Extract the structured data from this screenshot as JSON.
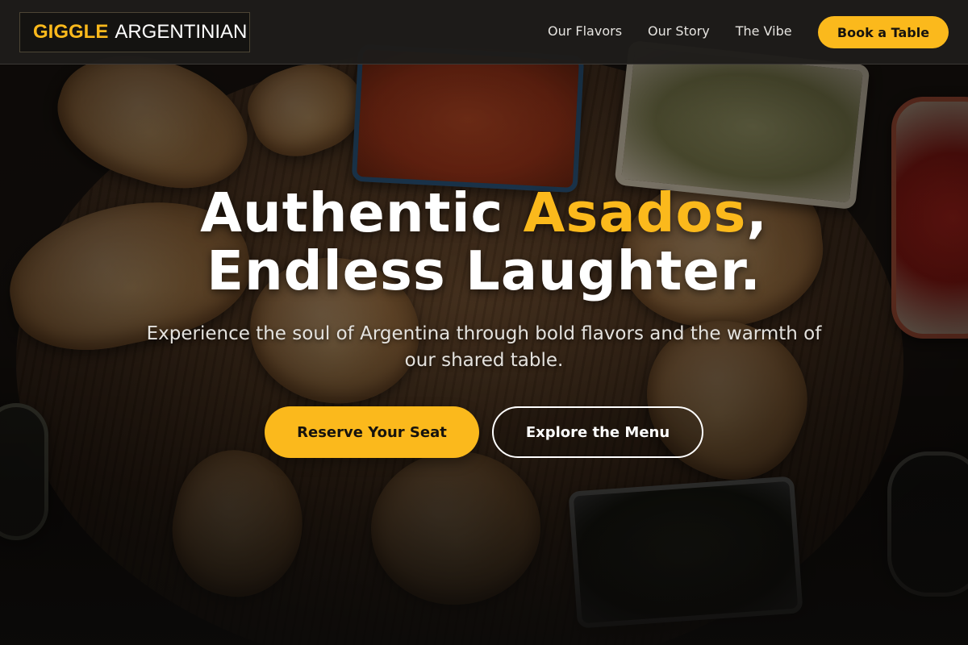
{
  "nav": {
    "logo_brand": "GIGGLE",
    "logo_sub": "ARGENTINIAN",
    "links": [
      "Our Flavors",
      "Our Story",
      "The Vibe"
    ],
    "cta": "Book a Table"
  },
  "hero": {
    "headline_part1": "Authentic ",
    "headline_accent": "Asados",
    "headline_part2": ",",
    "headline_line2": "Endless Laughter.",
    "subheadline": "Experience the soul of Argentina through bold flavors and the warmth of our shared table.",
    "primary_cta": "Reserve Your Seat",
    "secondary_cta": "Explore the Menu"
  },
  "colors": {
    "accent": "#fbb91c",
    "nav_background": "#1e1c1a",
    "text_primary": "#ffffff"
  }
}
